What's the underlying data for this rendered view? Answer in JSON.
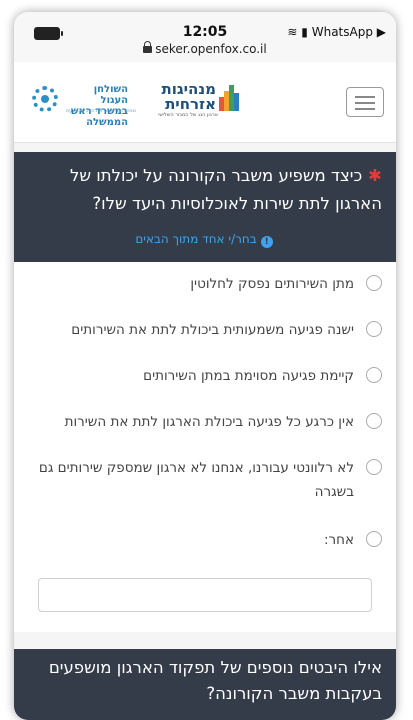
{
  "status_bar": {
    "time": "12:05",
    "network": "WhatsApp ▶",
    "url": "seker.openfox.co.il"
  },
  "header": {
    "logo_org1": "השולחן העגול",
    "logo_org1_line2": "במשרד ראש הממשלה",
    "logo_org1_sub": "ממשלה, חברה אזרחית, מגזר עסקי",
    "logo_org2": "מנהיגות",
    "logo_org2_line2": "אזרחית",
    "logo_org2_sub": "ארגון הגג של המגזר השלישי",
    "menu_icon": "hamburger-icon"
  },
  "question1": {
    "text": "כיצד משפיע משבר הקורונה על יכולתו של הארגון לתת שירות לאוכלוסיות היעד שלו?",
    "required_mark": "✱",
    "hint": "בחר/י אחד מתוך הבאים",
    "options": [
      "מתן השירותים נפסק לחלוטין",
      "ישנה פגיעה משמעותית ביכולת לתת את השירותים",
      "קיימת פגיעה מסוימת במתן השירותים",
      "אין כרגע כל פגיעה ביכולת הארגון לתת את השירות",
      "לא רלוונטי עבורנו, אנחנו לא ארגון שמספק שירותים גם בשגרה",
      "אחר:"
    ],
    "other_value": ""
  },
  "question2": {
    "text": "אילו היבטים נוספים של תפקוד הארגון מושפעים בעקבות משבר הקורונה?"
  },
  "colors": {
    "question_bg": "#333c48",
    "required": "#e63a3a",
    "hint": "#3fa4ea"
  }
}
